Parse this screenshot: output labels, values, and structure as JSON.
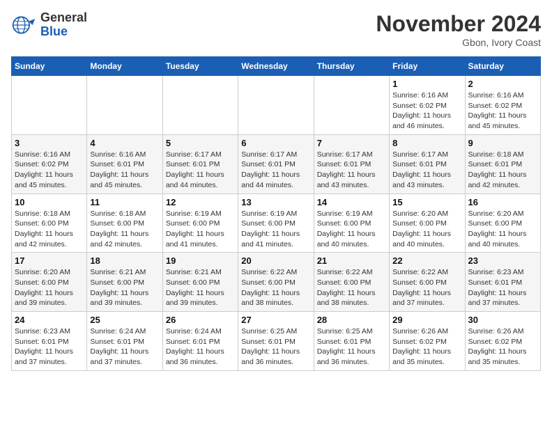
{
  "header": {
    "logo_line1": "General",
    "logo_line2": "Blue",
    "month": "November 2024",
    "location": "Gbon, Ivory Coast"
  },
  "weekdays": [
    "Sunday",
    "Monday",
    "Tuesday",
    "Wednesday",
    "Thursday",
    "Friday",
    "Saturday"
  ],
  "weeks": [
    [
      {
        "day": "",
        "sunrise": "",
        "sunset": "",
        "daylight": ""
      },
      {
        "day": "",
        "sunrise": "",
        "sunset": "",
        "daylight": ""
      },
      {
        "day": "",
        "sunrise": "",
        "sunset": "",
        "daylight": ""
      },
      {
        "day": "",
        "sunrise": "",
        "sunset": "",
        "daylight": ""
      },
      {
        "day": "",
        "sunrise": "",
        "sunset": "",
        "daylight": ""
      },
      {
        "day": "1",
        "sunrise": "Sunrise: 6:16 AM",
        "sunset": "Sunset: 6:02 PM",
        "daylight": "Daylight: 11 hours and 46 minutes."
      },
      {
        "day": "2",
        "sunrise": "Sunrise: 6:16 AM",
        "sunset": "Sunset: 6:02 PM",
        "daylight": "Daylight: 11 hours and 45 minutes."
      }
    ],
    [
      {
        "day": "3",
        "sunrise": "Sunrise: 6:16 AM",
        "sunset": "Sunset: 6:02 PM",
        "daylight": "Daylight: 11 hours and 45 minutes."
      },
      {
        "day": "4",
        "sunrise": "Sunrise: 6:16 AM",
        "sunset": "Sunset: 6:01 PM",
        "daylight": "Daylight: 11 hours and 45 minutes."
      },
      {
        "day": "5",
        "sunrise": "Sunrise: 6:17 AM",
        "sunset": "Sunset: 6:01 PM",
        "daylight": "Daylight: 11 hours and 44 minutes."
      },
      {
        "day": "6",
        "sunrise": "Sunrise: 6:17 AM",
        "sunset": "Sunset: 6:01 PM",
        "daylight": "Daylight: 11 hours and 44 minutes."
      },
      {
        "day": "7",
        "sunrise": "Sunrise: 6:17 AM",
        "sunset": "Sunset: 6:01 PM",
        "daylight": "Daylight: 11 hours and 43 minutes."
      },
      {
        "day": "8",
        "sunrise": "Sunrise: 6:17 AM",
        "sunset": "Sunset: 6:01 PM",
        "daylight": "Daylight: 11 hours and 43 minutes."
      },
      {
        "day": "9",
        "sunrise": "Sunrise: 6:18 AM",
        "sunset": "Sunset: 6:01 PM",
        "daylight": "Daylight: 11 hours and 42 minutes."
      }
    ],
    [
      {
        "day": "10",
        "sunrise": "Sunrise: 6:18 AM",
        "sunset": "Sunset: 6:00 PM",
        "daylight": "Daylight: 11 hours and 42 minutes."
      },
      {
        "day": "11",
        "sunrise": "Sunrise: 6:18 AM",
        "sunset": "Sunset: 6:00 PM",
        "daylight": "Daylight: 11 hours and 42 minutes."
      },
      {
        "day": "12",
        "sunrise": "Sunrise: 6:19 AM",
        "sunset": "Sunset: 6:00 PM",
        "daylight": "Daylight: 11 hours and 41 minutes."
      },
      {
        "day": "13",
        "sunrise": "Sunrise: 6:19 AM",
        "sunset": "Sunset: 6:00 PM",
        "daylight": "Daylight: 11 hours and 41 minutes."
      },
      {
        "day": "14",
        "sunrise": "Sunrise: 6:19 AM",
        "sunset": "Sunset: 6:00 PM",
        "daylight": "Daylight: 11 hours and 40 minutes."
      },
      {
        "day": "15",
        "sunrise": "Sunrise: 6:20 AM",
        "sunset": "Sunset: 6:00 PM",
        "daylight": "Daylight: 11 hours and 40 minutes."
      },
      {
        "day": "16",
        "sunrise": "Sunrise: 6:20 AM",
        "sunset": "Sunset: 6:00 PM",
        "daylight": "Daylight: 11 hours and 40 minutes."
      }
    ],
    [
      {
        "day": "17",
        "sunrise": "Sunrise: 6:20 AM",
        "sunset": "Sunset: 6:00 PM",
        "daylight": "Daylight: 11 hours and 39 minutes."
      },
      {
        "day": "18",
        "sunrise": "Sunrise: 6:21 AM",
        "sunset": "Sunset: 6:00 PM",
        "daylight": "Daylight: 11 hours and 39 minutes."
      },
      {
        "day": "19",
        "sunrise": "Sunrise: 6:21 AM",
        "sunset": "Sunset: 6:00 PM",
        "daylight": "Daylight: 11 hours and 39 minutes."
      },
      {
        "day": "20",
        "sunrise": "Sunrise: 6:22 AM",
        "sunset": "Sunset: 6:00 PM",
        "daylight": "Daylight: 11 hours and 38 minutes."
      },
      {
        "day": "21",
        "sunrise": "Sunrise: 6:22 AM",
        "sunset": "Sunset: 6:00 PM",
        "daylight": "Daylight: 11 hours and 38 minutes."
      },
      {
        "day": "22",
        "sunrise": "Sunrise: 6:22 AM",
        "sunset": "Sunset: 6:00 PM",
        "daylight": "Daylight: 11 hours and 37 minutes."
      },
      {
        "day": "23",
        "sunrise": "Sunrise: 6:23 AM",
        "sunset": "Sunset: 6:01 PM",
        "daylight": "Daylight: 11 hours and 37 minutes."
      }
    ],
    [
      {
        "day": "24",
        "sunrise": "Sunrise: 6:23 AM",
        "sunset": "Sunset: 6:01 PM",
        "daylight": "Daylight: 11 hours and 37 minutes."
      },
      {
        "day": "25",
        "sunrise": "Sunrise: 6:24 AM",
        "sunset": "Sunset: 6:01 PM",
        "daylight": "Daylight: 11 hours and 37 minutes."
      },
      {
        "day": "26",
        "sunrise": "Sunrise: 6:24 AM",
        "sunset": "Sunset: 6:01 PM",
        "daylight": "Daylight: 11 hours and 36 minutes."
      },
      {
        "day": "27",
        "sunrise": "Sunrise: 6:25 AM",
        "sunset": "Sunset: 6:01 PM",
        "daylight": "Daylight: 11 hours and 36 minutes."
      },
      {
        "day": "28",
        "sunrise": "Sunrise: 6:25 AM",
        "sunset": "Sunset: 6:01 PM",
        "daylight": "Daylight: 11 hours and 36 minutes."
      },
      {
        "day": "29",
        "sunrise": "Sunrise: 6:26 AM",
        "sunset": "Sunset: 6:02 PM",
        "daylight": "Daylight: 11 hours and 35 minutes."
      },
      {
        "day": "30",
        "sunrise": "Sunrise: 6:26 AM",
        "sunset": "Sunset: 6:02 PM",
        "daylight": "Daylight: 11 hours and 35 minutes."
      }
    ]
  ]
}
